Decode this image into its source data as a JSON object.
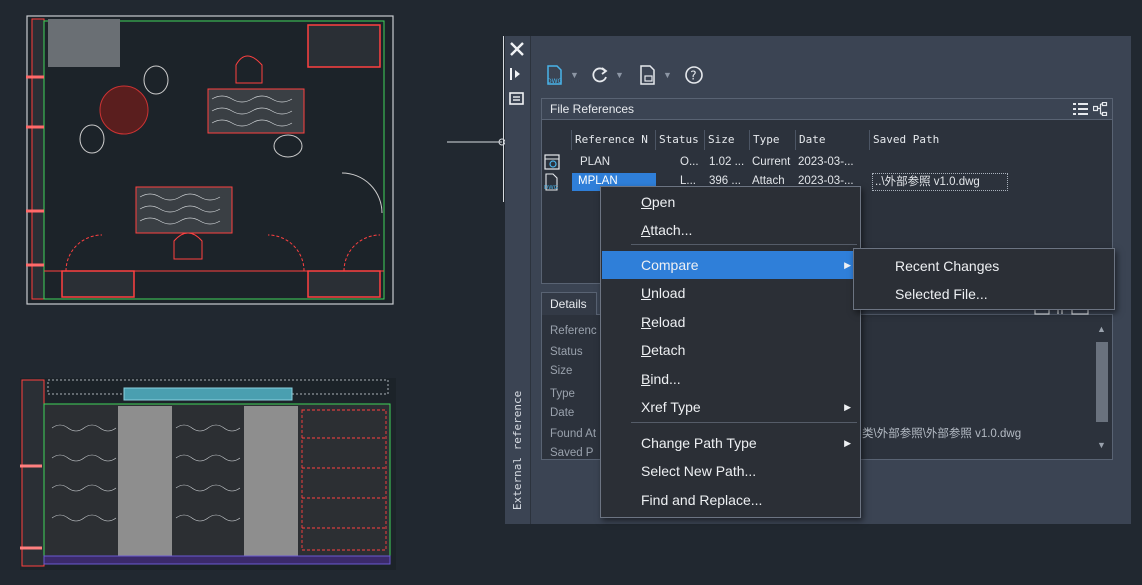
{
  "palette": {
    "title": "External reference",
    "toolbar": {
      "attach_icon": "attach-dwg-icon",
      "refresh_icon": "refresh-icon",
      "change_path_icon": "change-path-icon",
      "help_icon": "help-icon"
    },
    "file_references": {
      "label": "File References",
      "columns": [
        "Reference N",
        "Status",
        "Size",
        "Type",
        "Date",
        "Saved Path"
      ],
      "rows": [
        {
          "name": "PLAN",
          "status": "O...",
          "size": "1.02 ...",
          "type": "Current",
          "date": "2023-03-...",
          "saved_path": "",
          "icon": "drawing-root-icon"
        },
        {
          "name": "MPLAN",
          "status": "L...",
          "size": "396 ...",
          "type": "Attach",
          "date": "2023-03-...",
          "saved_path": "..\\外部参照 v1.0.dwg",
          "icon": "dwg-file-icon"
        }
      ]
    },
    "details": {
      "tab_label": "Details",
      "labels": [
        "Referenc",
        "Status",
        "Size",
        "Type",
        "Date",
        "Found At",
        "Saved P"
      ],
      "found_at_value": "类\\外部参照\\外部参照 v1.0.dwg"
    }
  },
  "context_menu": {
    "items": [
      {
        "label": "Open",
        "accel": "O"
      },
      {
        "label": "Attach...",
        "accel": "A"
      },
      {
        "label": "Compare",
        "accel": "",
        "submenu": true
      },
      {
        "label": "Unload",
        "accel": "U"
      },
      {
        "label": "Reload",
        "accel": "R"
      },
      {
        "label": "Detach",
        "accel": "D"
      },
      {
        "label": "Bind...",
        "accel": "B"
      },
      {
        "label": "Xref Type",
        "accel": "",
        "submenu": true
      },
      {
        "label": "Change Path Type",
        "accel": "",
        "submenu": true
      },
      {
        "label": "Select New Path...",
        "accel": ""
      },
      {
        "label": "Find and Replace...",
        "accel": ""
      }
    ]
  },
  "submenu": {
    "items": [
      "Recent Changes",
      "Selected File..."
    ]
  },
  "colors": {
    "background": "#212830",
    "panel": "#3b4453",
    "highlight": "#2f7fd9",
    "accent_icon": "#49b3ea"
  }
}
